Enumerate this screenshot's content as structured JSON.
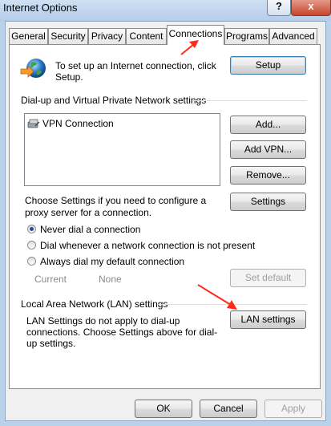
{
  "window": {
    "title": "Internet Options",
    "help_glyph": "?",
    "close_glyph": "x"
  },
  "tabs": [
    {
      "label": "General"
    },
    {
      "label": "Security"
    },
    {
      "label": "Privacy"
    },
    {
      "label": "Content"
    },
    {
      "label": "Connections",
      "active": true
    },
    {
      "label": "Programs"
    },
    {
      "label": "Advanced"
    }
  ],
  "setup": {
    "description": "To set up an Internet connection, click Setup.",
    "button": "Setup"
  },
  "dialup": {
    "group_label": "Dial-up and Virtual Private Network settings",
    "connections": [
      "VPN Connection"
    ],
    "add_button": "Add...",
    "add_vpn_button": "Add VPN...",
    "remove_button": "Remove...",
    "proxy_text": "Choose Settings if you need to configure a proxy server for a connection.",
    "settings_button": "Settings",
    "options": [
      {
        "label": "Never dial a connection",
        "selected": true
      },
      {
        "label": "Dial whenever a network connection is not present",
        "selected": false
      },
      {
        "label": "Always dial my default connection",
        "selected": false
      }
    ],
    "current_label": "Current",
    "current_value": "None",
    "set_default_button": "Set default"
  },
  "lan": {
    "group_label": "Local Area Network (LAN) settings",
    "description": "LAN Settings do not apply to dial-up connections. Choose Settings above for dial-up settings.",
    "button": "LAN settings"
  },
  "footer": {
    "ok": "OK",
    "cancel": "Cancel",
    "apply": "Apply"
  },
  "colors": {
    "annotation_arrow": "#ff2a1a",
    "window_frame": "#b9d1ea",
    "dialog_bg": "#f0f0f0"
  }
}
